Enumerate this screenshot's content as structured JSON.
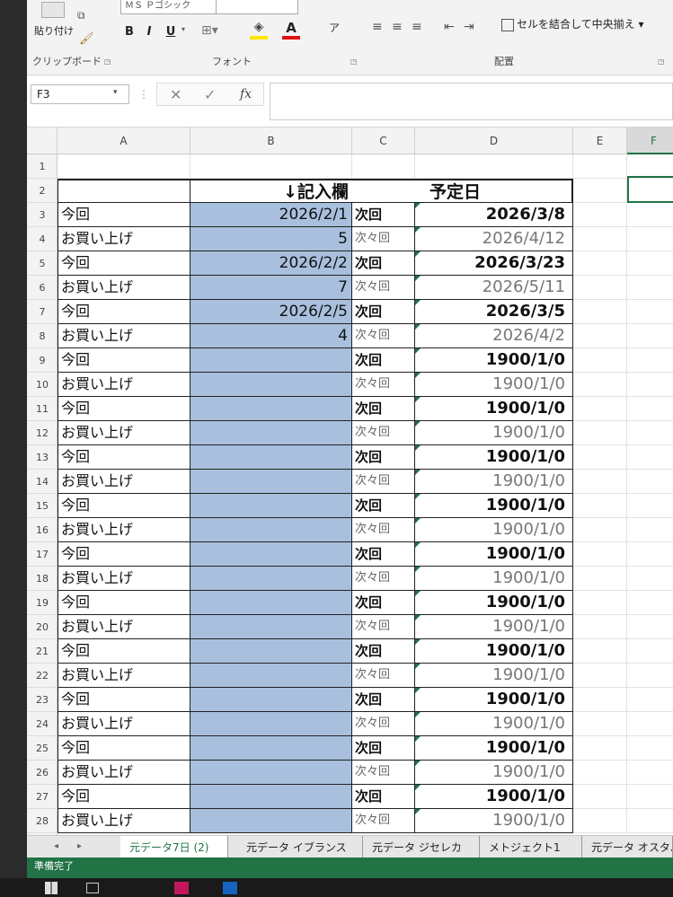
{
  "ribbon": {
    "font_name": "ＭＳ Ｐゴシック",
    "paste_label": "貼り付け",
    "bold": "B",
    "italic": "I",
    "underline": "U",
    "font_color_glyph": "A",
    "phonetic_glyph": "ア",
    "merge_label": "セルを結合して中央揃え",
    "groups": {
      "clipboard": "クリップボード",
      "font": "フォント",
      "alignment": "配置"
    }
  },
  "formula_bar": {
    "name_box": "F3",
    "fx": "fx",
    "value": ""
  },
  "columns": [
    "A",
    "B",
    "C",
    "D",
    "E",
    "F"
  ],
  "header_row": {
    "b": "↓記入欄",
    "d": "予定日"
  },
  "rows": [
    {
      "row": "1",
      "a": "",
      "b": "",
      "c": "",
      "d": ""
    },
    {
      "row": "2",
      "a": "",
      "b": "↓記入欄",
      "c": "",
      "d": "予定日"
    },
    {
      "row": "3",
      "a": "今回",
      "b": "2026/2/1",
      "c": "次回",
      "d": "2026/3/8"
    },
    {
      "row": "4",
      "a": "お買い上げ",
      "b": "5",
      "c": "次々回",
      "d": "2026/4/12"
    },
    {
      "row": "5",
      "a": "今回",
      "b": "2026/2/2",
      "c": "次回",
      "d": "2026/3/23"
    },
    {
      "row": "6",
      "a": "お買い上げ",
      "b": "7",
      "c": "次々回",
      "d": "2026/5/11"
    },
    {
      "row": "7",
      "a": "今回",
      "b": "2026/2/5",
      "c": "次回",
      "d": "2026/3/5"
    },
    {
      "row": "8",
      "a": "お買い上げ",
      "b": "4",
      "c": "次々回",
      "d": "2026/4/2"
    },
    {
      "row": "9",
      "a": "今回",
      "b": "",
      "c": "次回",
      "d": "1900/1/0"
    },
    {
      "row": "10",
      "a": "お買い上げ",
      "b": "",
      "c": "次々回",
      "d": "1900/1/0"
    },
    {
      "row": "11",
      "a": "今回",
      "b": "",
      "c": "次回",
      "d": "1900/1/0"
    },
    {
      "row": "12",
      "a": "お買い上げ",
      "b": "",
      "c": "次々回",
      "d": "1900/1/0"
    },
    {
      "row": "13",
      "a": "今回",
      "b": "",
      "c": "次回",
      "d": "1900/1/0"
    },
    {
      "row": "14",
      "a": "お買い上げ",
      "b": "",
      "c": "次々回",
      "d": "1900/1/0"
    },
    {
      "row": "15",
      "a": "今回",
      "b": "",
      "c": "次回",
      "d": "1900/1/0"
    },
    {
      "row": "16",
      "a": "お買い上げ",
      "b": "",
      "c": "次々回",
      "d": "1900/1/0"
    },
    {
      "row": "17",
      "a": "今回",
      "b": "",
      "c": "次回",
      "d": "1900/1/0"
    },
    {
      "row": "18",
      "a": "お買い上げ",
      "b": "",
      "c": "次々回",
      "d": "1900/1/0"
    },
    {
      "row": "19",
      "a": "今回",
      "b": "",
      "c": "次回",
      "d": "1900/1/0"
    },
    {
      "row": "20",
      "a": "お買い上げ",
      "b": "",
      "c": "次々回",
      "d": "1900/1/0"
    },
    {
      "row": "21",
      "a": "今回",
      "b": "",
      "c": "次回",
      "d": "1900/1/0"
    },
    {
      "row": "22",
      "a": "お買い上げ",
      "b": "",
      "c": "次々回",
      "d": "1900/1/0"
    },
    {
      "row": "23",
      "a": "今回",
      "b": "",
      "c": "次回",
      "d": "1900/1/0"
    },
    {
      "row": "24",
      "a": "お買い上げ",
      "b": "",
      "c": "次々回",
      "d": "1900/1/0"
    },
    {
      "row": "25",
      "a": "今回",
      "b": "",
      "c": "次回",
      "d": "1900/1/0"
    },
    {
      "row": "26",
      "a": "お買い上げ",
      "b": "",
      "c": "次々回",
      "d": "1900/1/0"
    },
    {
      "row": "27",
      "a": "今回",
      "b": "",
      "c": "次回",
      "d": "1900/1/0"
    },
    {
      "row": "28",
      "a": "お買い上げ",
      "b": "",
      "c": "次々回",
      "d": "1900/1/0"
    }
  ],
  "sheet_tabs": [
    {
      "label": "元データ7日 (2)",
      "active": true
    },
    {
      "label": "元データ イブランス",
      "active": false
    },
    {
      "label": "元データ ジセレカ",
      "active": false
    },
    {
      "label": "メトジェクト1",
      "active": false
    },
    {
      "label": "元データ オスタバ",
      "active": false
    }
  ],
  "status": "準備完了",
  "colors": {
    "input_fill": "#a8c0de",
    "excel_green": "#217346"
  }
}
